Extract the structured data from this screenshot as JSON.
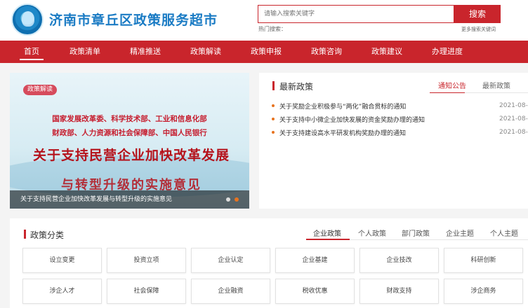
{
  "header": {
    "site_title": "济南市章丘区政策服务超市",
    "logo_icon": "circular-emblem-icon",
    "search": {
      "placeholder": "请输入搜索关键字",
      "button_label": "搜索"
    },
    "hot_label": "热门搜索：",
    "more_keywords": "更多搜索关键词"
  },
  "nav": {
    "items": [
      {
        "label": "首页",
        "active": true
      },
      {
        "label": "政策清单"
      },
      {
        "label": "精准推送"
      },
      {
        "label": "政策解读"
      },
      {
        "label": "政策申报"
      },
      {
        "label": "政策咨询"
      },
      {
        "label": "政策建议"
      },
      {
        "label": "办理进度"
      }
    ]
  },
  "banner": {
    "tag": "政策解读",
    "line1": "国家发展改革委、科学技术部、工业和信息化部",
    "line2": "财政部、人力资源和社会保障部、中国人民银行",
    "headline1": "关于支持民营企业加快改革发展",
    "headline2": "与转型升级的实施意见",
    "caption": "关于支持民营企业加快改革发展与转型升级的实施意见"
  },
  "news": {
    "title": "最新政策",
    "tabs": [
      {
        "label": "通知公告",
        "active": true
      },
      {
        "label": "最新政策"
      }
    ],
    "items": [
      {
        "text": "关于奖励企业积极参与“两化”融合贯标的通知",
        "date": "2021-08-"
      },
      {
        "text": "关于支持中小微企业加快发展的资金奖励办理的通知",
        "date": "2021-08-"
      },
      {
        "text": "关于支持建设高水平研发机构奖励办理的通知",
        "date": "2021-08-"
      }
    ]
  },
  "categories": {
    "title": "政策分类",
    "tabs": [
      {
        "label": "企业政策",
        "active": true
      },
      {
        "label": "个人政策"
      },
      {
        "label": "部门政策"
      },
      {
        "label": "企业主题"
      },
      {
        "label": "个人主题"
      }
    ],
    "cells": [
      "设立变更",
      "投资立项",
      "企业认定",
      "企业基建",
      "企业技改",
      "科研创新",
      "涉企人才",
      "社会保障",
      "企业融资",
      "税收优惠",
      "财政支持",
      "涉企商务"
    ]
  },
  "colors": {
    "brand_red": "#c9252c",
    "title_blue": "#1a7bc4",
    "bullet_orange": "#e7731f"
  }
}
